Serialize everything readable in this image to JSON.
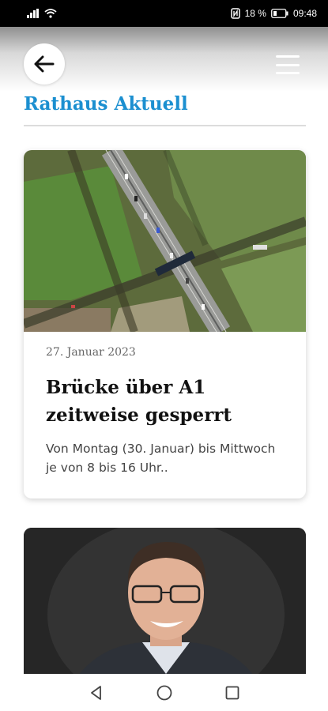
{
  "status_bar": {
    "signal_icon": "signal-icon",
    "wifi_icon": "wifi-icon",
    "nfc_icon": "nfc-icon",
    "battery_percent": "18 %",
    "battery_icon": "battery-icon",
    "time": "09:48"
  },
  "header": {
    "back_icon": "arrow-left-icon",
    "menu_icon": "hamburger-menu-icon",
    "title": "Rathaus Aktuell",
    "title_color": "#1b8fd0"
  },
  "articles": [
    {
      "image": "aerial-highway-bridge-photo",
      "date": "27. Januar 2023",
      "title": "Brücke über A1 zeitweise gesperrt",
      "excerpt": "Von Montag (30. Januar) bis Mittwoch je von 8 bis 16 Uhr.."
    },
    {
      "image": "portrait-man-glasses-photo"
    }
  ],
  "nav_bar": {
    "back": "triangle-back-icon",
    "home": "circle-home-icon",
    "recents": "square-recents-icon"
  }
}
